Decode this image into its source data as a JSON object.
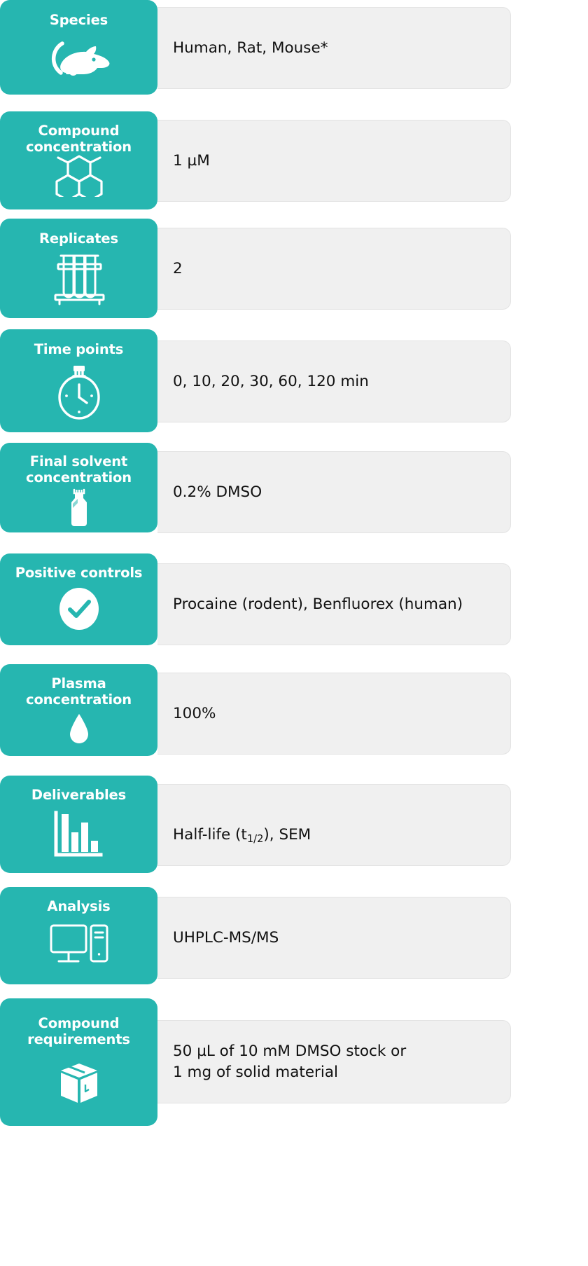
{
  "theme": {
    "accent": "#26b6b0",
    "panel_bg": "#f0f0f0",
    "panel_border": "#e3e3e3",
    "label_text": "#ffffff",
    "value_text": "#111111"
  },
  "rows": [
    {
      "label": "Species",
      "icon": "mouse-icon",
      "value": "Human, Rat, Mouse*"
    },
    {
      "label": "Compound\nconcentration",
      "icon": "molecule-hexagons-icon",
      "value": "1 µM"
    },
    {
      "label": "Replicates",
      "icon": "test-tube-rack-icon",
      "value": "2"
    },
    {
      "label": "Time points",
      "icon": "stopwatch-icon",
      "value": "0, 10, 20, 30, 60, 120 min"
    },
    {
      "label": "Final solvent\nconcentration",
      "icon": "solvent-bottle-icon",
      "value": "0.2% DMSO"
    },
    {
      "label": "Positive controls",
      "icon": "check-circle-icon",
      "value": "Procaine (rodent), Benfluorex (human)"
    },
    {
      "label": "Plasma\nconcentration",
      "icon": "droplet-icon",
      "value": "100%"
    },
    {
      "label": "Deliverables",
      "icon": "bar-chart-icon",
      "value_parts": [
        "Half-life (t",
        "1/2",
        "), SEM"
      ]
    },
    {
      "label": "Analysis",
      "icon": "computer-icon",
      "value": "UHPLC-MS/MS"
    },
    {
      "label": "Compound\nrequirements",
      "icon": "package-box-icon",
      "value": "50 µL of 10 mM DMSO stock or\n1 mg of solid material"
    }
  ]
}
